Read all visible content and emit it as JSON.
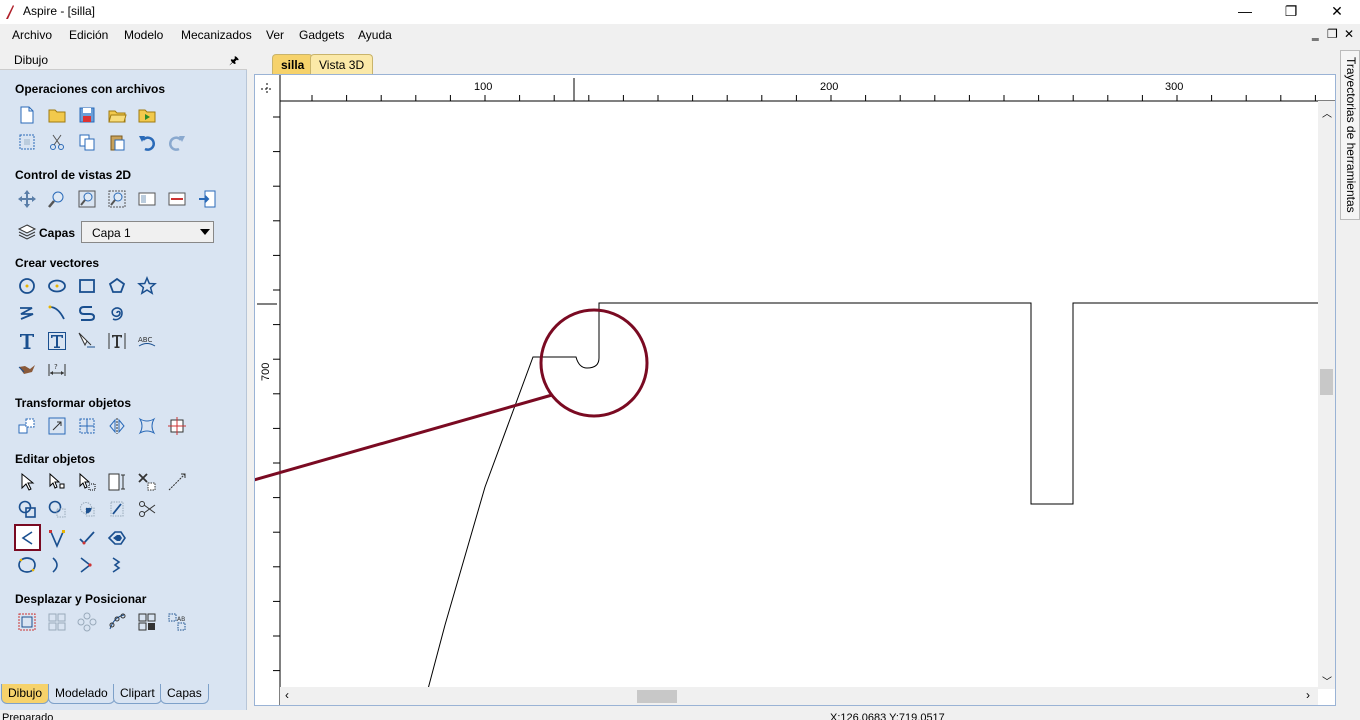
{
  "window": {
    "title": "Aspire - [silla]",
    "controls": {
      "minimize": "—",
      "restore": "❐",
      "close": "✕"
    }
  },
  "menubar": {
    "items": [
      "Archivo",
      "Edición",
      "Modelo",
      "Mecanizados",
      "Ver",
      "Gadgets",
      "Ayuda"
    ],
    "mdi": {
      "minimize": "‗",
      "restore": "❐",
      "close": "✕"
    }
  },
  "panel": {
    "header": "Dibujo",
    "pin": "🖈",
    "sections": {
      "file_ops": "Operaciones con archivos",
      "view2d": "Control de vistas 2D",
      "layers_label": "Capas",
      "layer_value": "Capa 1",
      "create_vectors": "Crear vectores",
      "transform": "Transformar objetos",
      "edit": "Editar objetos",
      "move": "Desplazar y Posicionar"
    },
    "bottom_tabs": [
      "Dibujo",
      "Modelado",
      "Clipart",
      "Capas"
    ]
  },
  "doc_tabs": [
    "silla",
    "Vista 3D"
  ],
  "ruler": {
    "h_labels": [
      "100",
      "200",
      "300"
    ],
    "v_labels": [
      "700"
    ]
  },
  "right_tab": "Trayectorias de herramientas",
  "status": {
    "left": "Preparado",
    "coords": "X:126.0683 Y:719.0517"
  },
  "colors": {
    "panel_bg": "#d9e4f2",
    "active_tab": "#f6d26b",
    "annotation": "#7a0a22",
    "icon_blue": "#2a6ab8"
  }
}
